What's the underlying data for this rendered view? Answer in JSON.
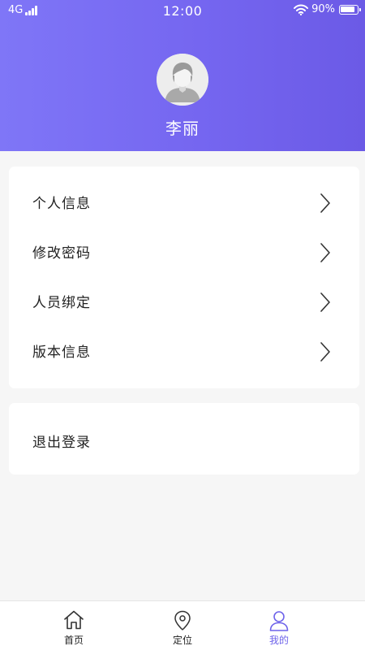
{
  "status_bar": {
    "network": "4G",
    "time": "12:00",
    "battery_percent": "90%",
    "battery_level": 0.9
  },
  "profile": {
    "name": "李丽"
  },
  "menu": {
    "items": [
      {
        "label": "个人信息",
        "icon": "chevron-right-icon"
      },
      {
        "label": "修改密码",
        "icon": "chevron-right-icon"
      },
      {
        "label": "人员绑定",
        "icon": "chevron-right-icon"
      },
      {
        "label": "版本信息",
        "icon": "chevron-right-icon"
      }
    ]
  },
  "logout": {
    "label": "退出登录"
  },
  "tabbar": {
    "tabs": [
      {
        "label": "首页",
        "icon": "home-icon",
        "active": false
      },
      {
        "label": "定位",
        "icon": "location-pin-icon",
        "active": false
      },
      {
        "label": "我的",
        "icon": "user-icon",
        "active": true
      }
    ]
  },
  "colors": {
    "header_gradient_start": "#7f76f7",
    "header_gradient_end": "#6b5ae6",
    "active_tab": "#6e63ea",
    "background": "#f6f6f6"
  }
}
